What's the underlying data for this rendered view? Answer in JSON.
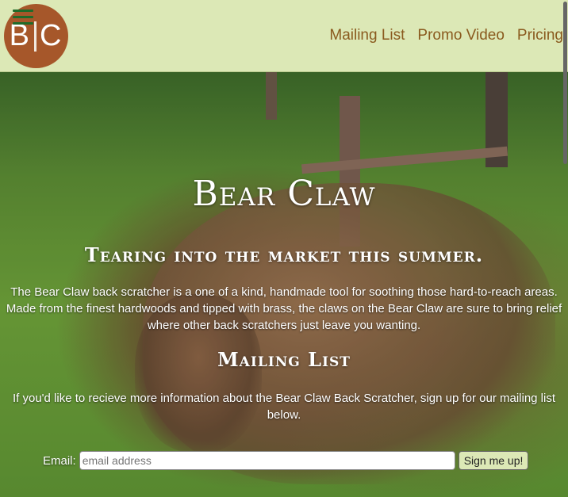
{
  "header": {
    "menu_icon": "hamburger-menu-icon",
    "logo": {
      "left": "B",
      "right": "C"
    },
    "nav": [
      "Mailing List",
      "Promo Video",
      "Pricing"
    ]
  },
  "hero": {
    "title": "Bear Claw",
    "subtitle": "Tearing into the market this summer.",
    "description": "The Bear Claw back scratcher is a one of a kind, handmade tool for soothing those hard-to-reach areas. Made from the finest hardwoods and tipped with brass, the claws on the Bear Claw are sure to bring relief where other back scratchers just leave you wanting."
  },
  "mailing": {
    "heading": "Mailing List",
    "text": "If you'd like to recieve more information about the Bear Claw Back Scratcher, sign up for our mailing list below.",
    "email_label": "Email:",
    "email_placeholder": "email address",
    "submit_label": "Sign me up!"
  },
  "colors": {
    "header_bg": "#dce8b6",
    "nav_link": "#8a5a1e",
    "logo_bg": "#a6572a",
    "menu_icon": "#1f6b2a"
  }
}
